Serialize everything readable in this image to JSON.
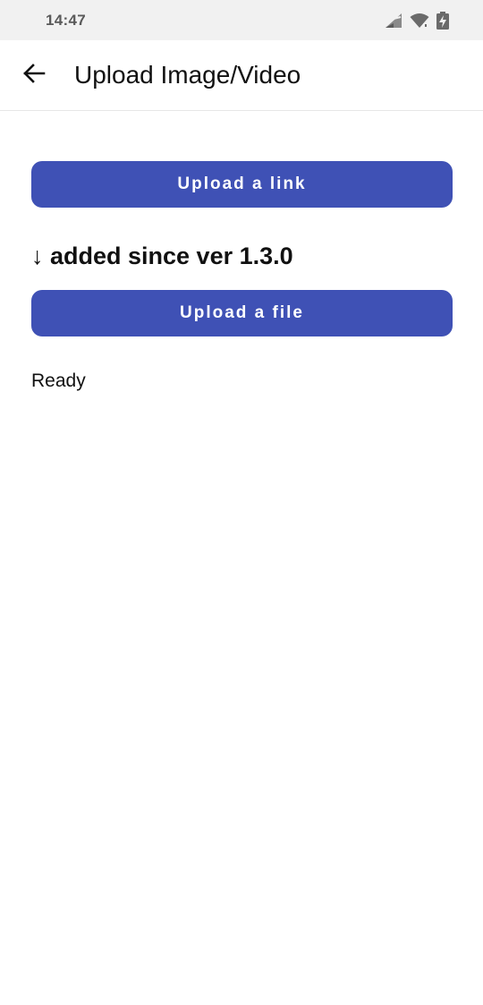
{
  "status_bar": {
    "time": "14:47",
    "icons": [
      "signal-icon",
      "wifi-icon",
      "battery-charging-icon"
    ]
  },
  "app_bar": {
    "back_icon": "arrow-left-icon",
    "title": "Upload Image/Video"
  },
  "main": {
    "upload_link_label": "Upload a link",
    "notice": "↓ added since ver 1.3.0",
    "upload_file_label": "Upload a file",
    "status": "Ready"
  },
  "colors": {
    "accent": "#3f51b5",
    "status_bar_bg": "#f1f1f1"
  }
}
